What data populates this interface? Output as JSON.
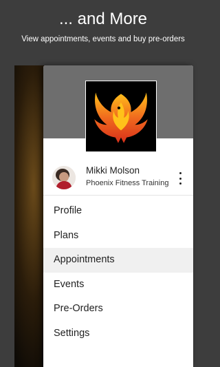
{
  "promo": {
    "title": "... and More",
    "subtitle": "View appointments, events and buy pre-orders"
  },
  "profile": {
    "name": "Mikki Molson",
    "organization": "Phoenix Fitness Training"
  },
  "menu": {
    "items": [
      {
        "label": "Profile"
      },
      {
        "label": "Plans"
      },
      {
        "label": "Appointments",
        "active": true
      },
      {
        "label": "Events"
      },
      {
        "label": "Pre-Orders"
      },
      {
        "label": "Settings"
      }
    ]
  },
  "icons": {
    "logo": "phoenix-logo",
    "more": "more-vert-icon"
  },
  "colors": {
    "background": "#3d3d3d",
    "header": "#6e6e6e",
    "active_item": "#f0f0f0",
    "logo_orange": "#f06a1e",
    "logo_yellow": "#ffc21a"
  }
}
